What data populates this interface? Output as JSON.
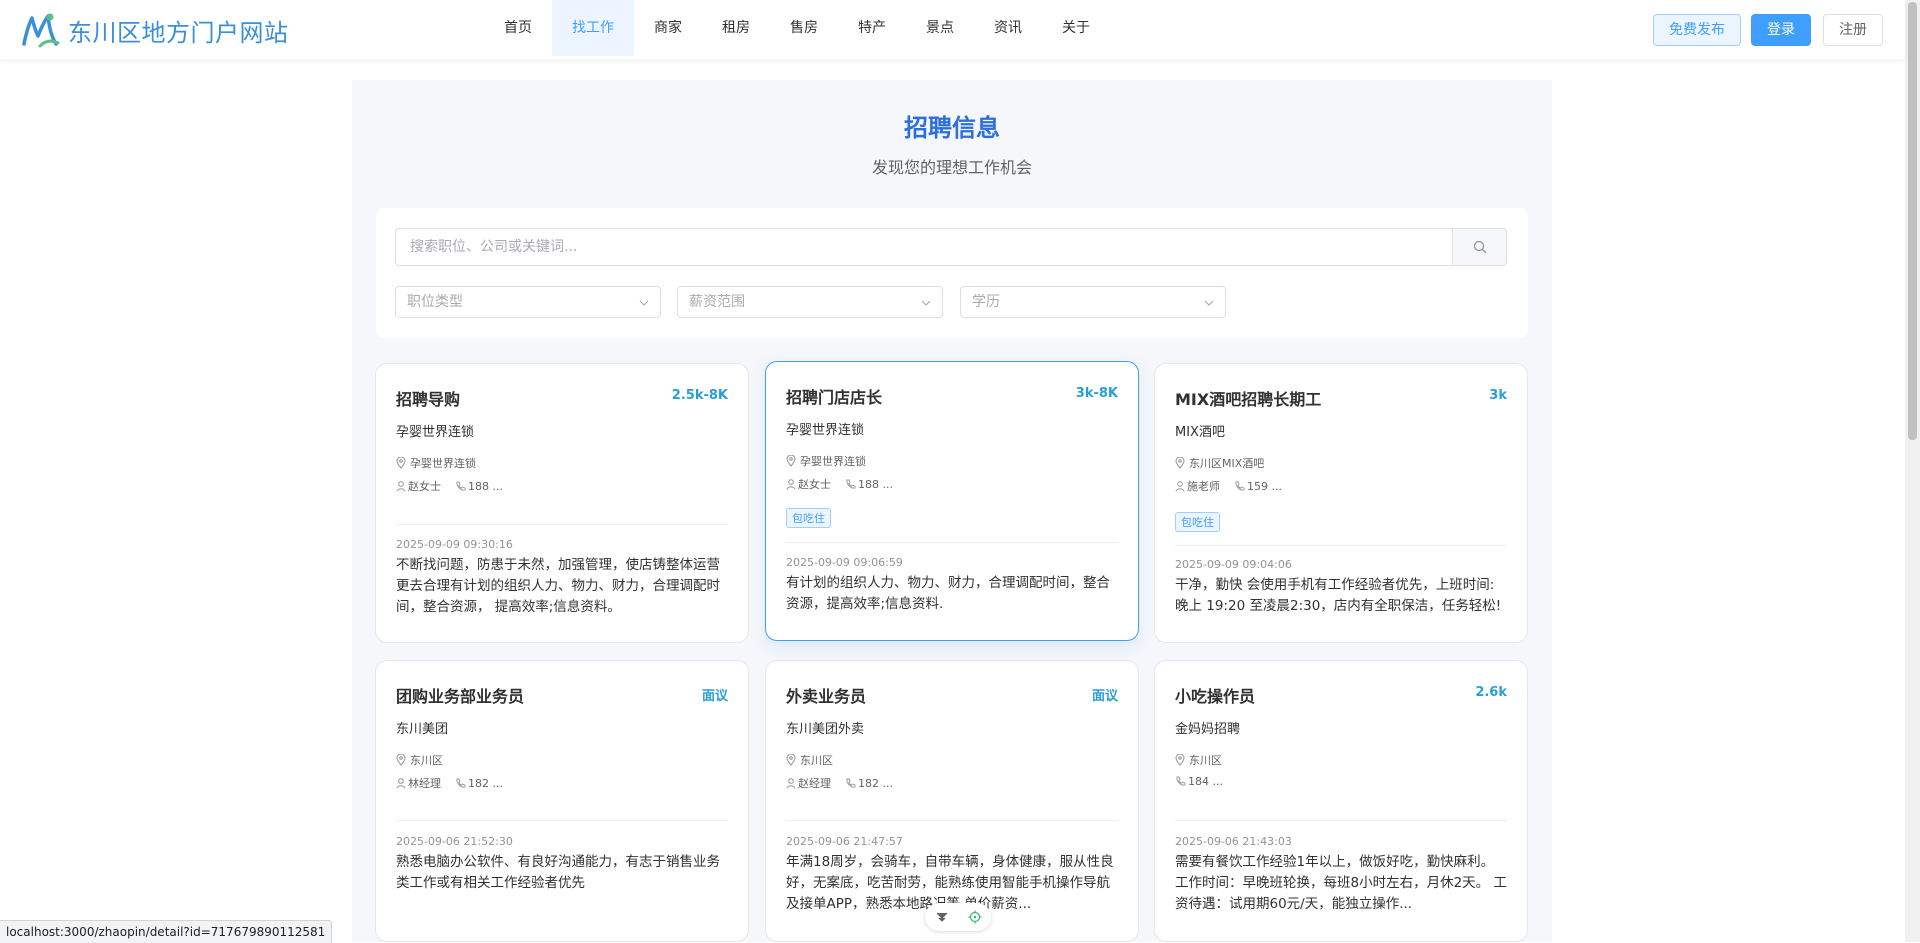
{
  "header": {
    "site_name": "东川区地方门户网站",
    "nav": [
      "首页",
      "找工作",
      "商家",
      "租房",
      "售房",
      "特产",
      "景点",
      "资讯",
      "关于"
    ],
    "active_nav": "找工作",
    "publish_label": "免费发布",
    "login_label": "登录",
    "register_label": "注册"
  },
  "main": {
    "title": "招聘信息",
    "subtitle": "发现您的理想工作机会"
  },
  "search": {
    "placeholder": "搜索职位、公司或关键词...",
    "filters": [
      "职位类型",
      "薪资范围",
      "学历"
    ]
  },
  "jobs": [
    {
      "title": "招聘导购",
      "salary": "2.5k-8K",
      "company": "孕婴世界连锁",
      "location": "孕婴世界连锁",
      "contact": "赵女士",
      "phone": "188 ...",
      "tag": "",
      "date": "2025-09-09 09:30:16",
      "desc": "不断找问题，防患于未然，加强管理，使店铸整体运营更去合理有计划的组织人力、物力、财力，合理调配时间，整合资源， 提高效率;信息资料。"
    },
    {
      "title": "招聘门店店长",
      "salary": "3k-8K",
      "company": "孕婴世界连锁",
      "location": "孕婴世界连锁",
      "contact": "赵女士",
      "phone": "188 ...",
      "tag": "包吃住",
      "date": "2025-09-09 09:06:59",
      "desc": "有计划的组织人力、物力、财力，合理调配时间，整合资源，提高效率;信息资料."
    },
    {
      "title": "MIX酒吧招聘长期工",
      "salary": "3k",
      "company": "MIX酒吧",
      "location": "东川区MIX酒吧",
      "contact": "施老师",
      "phone": "159 ...",
      "tag": "包吃住",
      "date": "2025-09-09 09:04:06",
      "desc": "干净，勤快 会使用手机有工作经验者优先，上班时间:晚上 19:20 至凌晨2:30，店内有全职保洁，任务轻松!"
    },
    {
      "title": "团购业务部业务员",
      "salary": "面议",
      "company": "东川美团",
      "location": "东川区",
      "contact": "林经理",
      "phone": "182 ...",
      "tag": "",
      "date": "2025-09-06 21:52:30",
      "desc": "熟悉电脑办公软件、有良好沟通能力，有志于销售业务类工作或有相关工作经验者优先"
    },
    {
      "title": "外卖业务员",
      "salary": "面议",
      "company": "东川美团外卖",
      "location": "东川区",
      "contact": "赵经理",
      "phone": "182 ...",
      "tag": "",
      "date": "2025-09-06 21:47:57",
      "desc": "年满18周岁，会骑车，自带车辆，身体健康，服从性良好，无案底，吃苦耐劳，能熟练使用智能手机操作导航及接单APP，熟悉本地路况等 单价薪资..."
    },
    {
      "title": "小吃操作员",
      "salary": "2.6k",
      "company": "金妈妈招聘",
      "location": "东川区",
      "contact": "",
      "phone": "184 ...",
      "tag": "",
      "date": "2025-09-06 21:43:03",
      "desc": "需要有餐饮工作经验1年以上，做饭好吃，勤快麻利。 工作时间：早晚班轮换，每班8小时左右，月休2天。 工资待遇：试用期60元/天，能独立操作..."
    }
  ],
  "status_url": "localhost:3000/zhaopin/detail?id=717679890112581",
  "colors": {
    "primary": "#409eff",
    "title_blue": "#2b6ee0",
    "salary": "#2a9fd6"
  }
}
